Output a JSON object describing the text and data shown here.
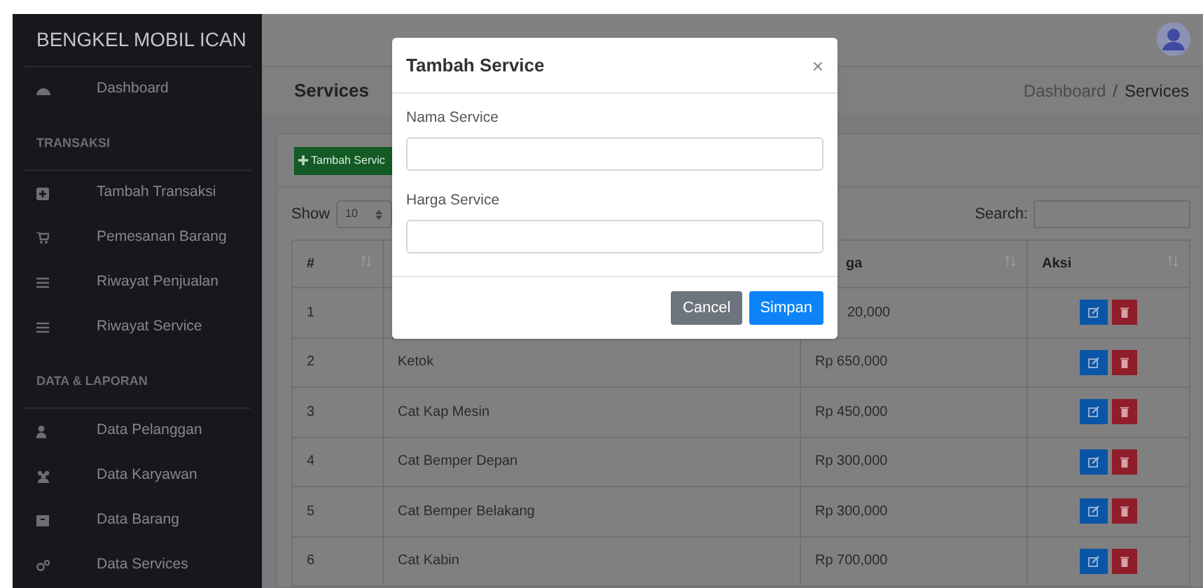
{
  "sidebar": {
    "brand": "BENGKEL MOBIL ICAN",
    "items": [
      {
        "kind": "link",
        "label": "Dashboard"
      },
      {
        "kind": "heading",
        "label": "TRANSAKSI"
      },
      {
        "kind": "link",
        "label": "Tambah Transaksi"
      },
      {
        "kind": "link",
        "label": "Pemesanan Barang"
      },
      {
        "kind": "link",
        "label": "Riwayat Penjualan"
      },
      {
        "kind": "link",
        "label": "Riwayat Service"
      },
      {
        "kind": "heading",
        "label": "DATA & LAPORAN"
      },
      {
        "kind": "link",
        "label": "Data Pelanggan"
      },
      {
        "kind": "link",
        "label": "Data Karyawan"
      },
      {
        "kind": "link",
        "label": "Data Barang"
      },
      {
        "kind": "link",
        "label": "Data Services"
      }
    ]
  },
  "page_header": {
    "title": "Services",
    "breadcrumb": [
      "Dashboard",
      "Services"
    ],
    "breadcrumb_separator": "/"
  },
  "card": {
    "add_button": "Tambah Servic",
    "show_label": "Show",
    "entries_select": "10",
    "search_label": "Search:",
    "table": {
      "columns": [
        "#",
        "",
        "ga",
        "Aksi"
      ],
      "rows": [
        {
          "cells": [
            "1",
            "",
            "20,000"
          ]
        },
        {
          "cells": [
            "2",
            "Ketok",
            "Rp 650,000"
          ]
        },
        {
          "cells": [
            "3",
            "Cat Kap Mesin",
            "Rp 450,000"
          ]
        },
        {
          "cells": [
            "4",
            "Cat Bemper Depan",
            "Rp 300,000"
          ]
        },
        {
          "cells": [
            "5",
            "Cat Bemper Belakang",
            "Rp 300,000"
          ]
        },
        {
          "cells": [
            "6",
            "Cat Kabin",
            "Rp 700,000"
          ]
        }
      ]
    }
  },
  "modal": {
    "title": "Tambah Service",
    "close": "×",
    "fields": [
      {
        "label": "Nama Service"
      },
      {
        "label": "Harga Service"
      }
    ],
    "buttons": [
      {
        "kind": "secondary",
        "label": "Cancel"
      },
      {
        "kind": "primary",
        "label": "Simpan"
      }
    ]
  }
}
